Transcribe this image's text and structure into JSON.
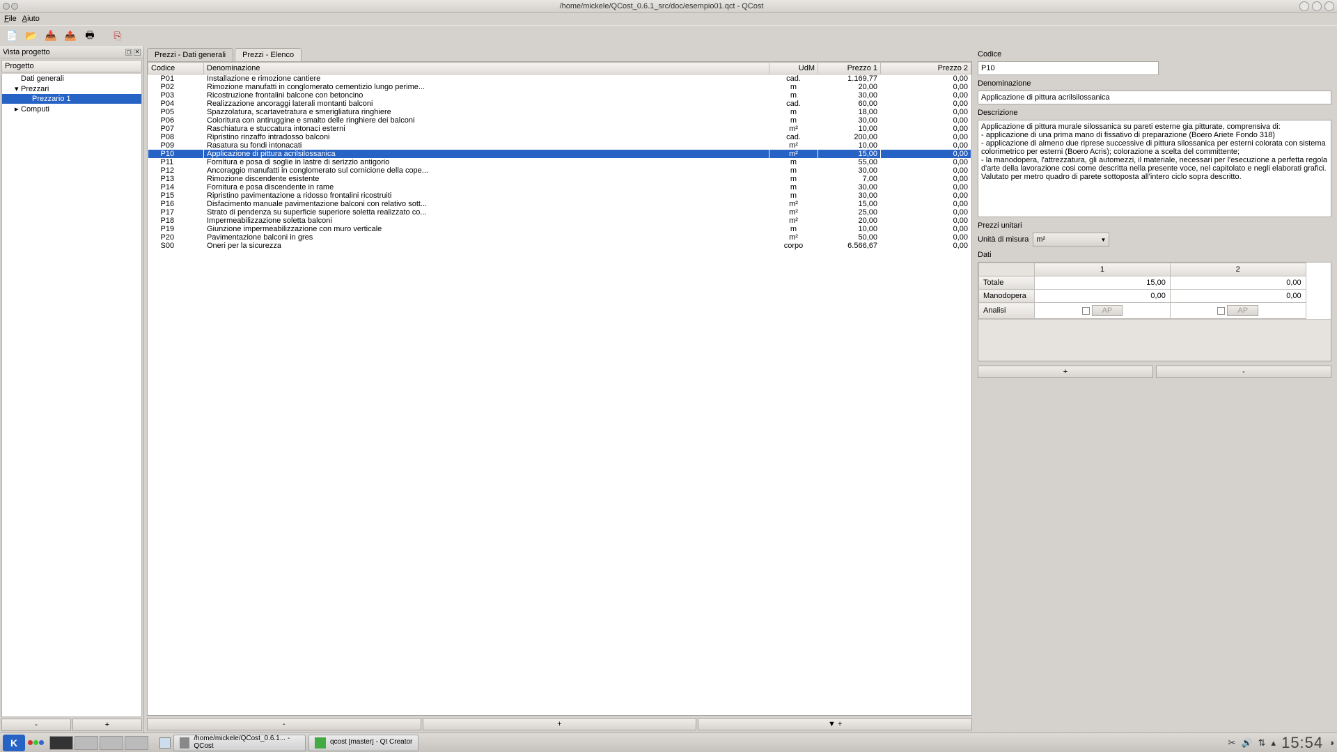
{
  "window": {
    "title": "/home/mickele/QCost_0.6.1_src/doc/esempio01.qct - QCost"
  },
  "menu": {
    "file": "File",
    "help": "Aiuto"
  },
  "project_panel": {
    "title": "Vista progetto",
    "header": "Progetto",
    "items": [
      {
        "label": "Dati generali",
        "indent": 1
      },
      {
        "label": "Prezzari",
        "indent": 1,
        "expander": "▾"
      },
      {
        "label": "Prezzario 1",
        "indent": 2,
        "selected": true
      },
      {
        "label": "Computi",
        "indent": 1,
        "expander": "▸"
      }
    ],
    "btn_minus": "-",
    "btn_plus": "+"
  },
  "tabs": {
    "general": "Prezzi - Dati generali",
    "list": "Prezzi - Elenco"
  },
  "table": {
    "headers": {
      "code": "Codice",
      "name": "Denominazione",
      "udm": "UdM",
      "p1": "Prezzo 1",
      "p2": "Prezzo 2"
    },
    "rows": [
      {
        "code": "P01",
        "name": "Installazione e rimozione cantiere",
        "udm": "cad.",
        "p1": "1.169,77",
        "p2": "0,00"
      },
      {
        "code": "P02",
        "name": "Rimozione manufatti in conglomerato cementizio lungo perime...",
        "udm": "m",
        "p1": "20,00",
        "p2": "0,00"
      },
      {
        "code": "P03",
        "name": "Ricostruzione frontalini balcone con betoncino",
        "udm": "m",
        "p1": "30,00",
        "p2": "0,00"
      },
      {
        "code": "P04",
        "name": "Realizzazione ancoraggi laterali montanti balconi",
        "udm": "cad.",
        "p1": "60,00",
        "p2": "0,00"
      },
      {
        "code": "P05",
        "name": "Spazzolatura, scartavetratura e smerigliatura ringhiere",
        "udm": "m",
        "p1": "18,00",
        "p2": "0,00"
      },
      {
        "code": "P06",
        "name": "Coloritura con antiruggine e smalto delle ringhiere dei balconi",
        "udm": "m",
        "p1": "30,00",
        "p2": "0,00"
      },
      {
        "code": "P07",
        "name": "Raschiatura e stuccatura intonaci esterni",
        "udm": "m²",
        "p1": "10,00",
        "p2": "0,00"
      },
      {
        "code": "P08",
        "name": "Ripristino rinzaffo intradosso balconi",
        "udm": "cad.",
        "p1": "200,00",
        "p2": "0,00"
      },
      {
        "code": "P09",
        "name": "Rasatura su fondi intonacati",
        "udm": "m²",
        "p1": "10,00",
        "p2": "0,00"
      },
      {
        "code": "P10",
        "name": "Applicazione di pittura acrilsilossanica",
        "udm": "m²",
        "p1": "15,00",
        "p2": "0,00",
        "selected": true
      },
      {
        "code": "P11",
        "name": "Fornitura e posa di soglie in lastre di serizzio antigorio",
        "udm": "m",
        "p1": "55,00",
        "p2": "0,00"
      },
      {
        "code": "P12",
        "name": "Ancoraggio manufatti in conglomerato sul cornicione della cope...",
        "udm": "m",
        "p1": "30,00",
        "p2": "0,00"
      },
      {
        "code": "P13",
        "name": "Rimozione discendente esistente",
        "udm": "m",
        "p1": "7,00",
        "p2": "0,00"
      },
      {
        "code": "P14",
        "name": "Fornitura e posa discendente in rame",
        "udm": "m",
        "p1": "30,00",
        "p2": "0,00"
      },
      {
        "code": "P15",
        "name": "Ripristino pavimentazione a ridosso frontalini ricostruiti",
        "udm": "m",
        "p1": "30,00",
        "p2": "0,00"
      },
      {
        "code": "P16",
        "name": "Disfacimento manuale pavimentazione balconi con relativo sott...",
        "udm": "m²",
        "p1": "15,00",
        "p2": "0,00"
      },
      {
        "code": "P17",
        "name": "Strato di pendenza su superficie superiore soletta realizzato co...",
        "udm": "m²",
        "p1": "25,00",
        "p2": "0,00"
      },
      {
        "code": "P18",
        "name": "Impermeabilizzazione soletta balconi",
        "udm": "m²",
        "p1": "20,00",
        "p2": "0,00"
      },
      {
        "code": "P19",
        "name": "Giunzione impermeabilizzazione con muro verticale",
        "udm": "m",
        "p1": "10,00",
        "p2": "0,00"
      },
      {
        "code": "P20",
        "name": "Pavimentazione balconi in gres",
        "udm": "m²",
        "p1": "50,00",
        "p2": "0,00"
      },
      {
        "code": "S00",
        "name": "Oneri per la sicurezza",
        "udm": "corpo",
        "p1": "6.566,67",
        "p2": "0,00"
      }
    ],
    "btn_minus": "-",
    "btn_plus": "+",
    "btn_down_plus": "▼ +"
  },
  "detail": {
    "labels": {
      "codice": "Codice",
      "denom": "Denominazione",
      "descr": "Descrizione",
      "prezzi_unitari": "Prezzi unitari",
      "udm": "Unità di misura",
      "dati": "Dati",
      "totale": "Totale",
      "manodopera": "Manodopera",
      "analisi": "Analisi",
      "col1": "1",
      "col2": "2",
      "ap": "AP"
    },
    "codice": "P10",
    "denom": "Applicazione di pittura acrilsilossanica",
    "descr": "Applicazione di pittura murale silossanica su pareti esterne gia pitturate, comprensiva di:\n- applicazione di una prima mano di fissativo di preparazione (Boero Ariete Fondo 318)\n- applicazione di almeno due riprese successive di pittura silossanica per esterni colorata con sistema colorimetrico per esterni (Boero Acris); colorazione a scelta del committente;\n- la manodopera, l'attrezzatura, gli automezzi, il materiale, necessari per l'esecuzione a perfetta regola d'arte della lavorazione cosi come descritta nella presente voce, nel capitolato e negli elaborati grafici.\nValutato per metro quadro di parete sottoposta all'intero ciclo sopra descritto.",
    "udm": "m²",
    "totale": {
      "c1": "15,00",
      "c2": "0,00"
    },
    "manodopera": {
      "c1": "0,00",
      "c2": "0,00"
    },
    "btn_plus": "+",
    "btn_minus": "-"
  },
  "taskbar": {
    "task1": "/home/mickele/QCost_0.6.1... - QCost",
    "task2": "qcost [master] - Qt Creator",
    "clock": "15:54"
  }
}
